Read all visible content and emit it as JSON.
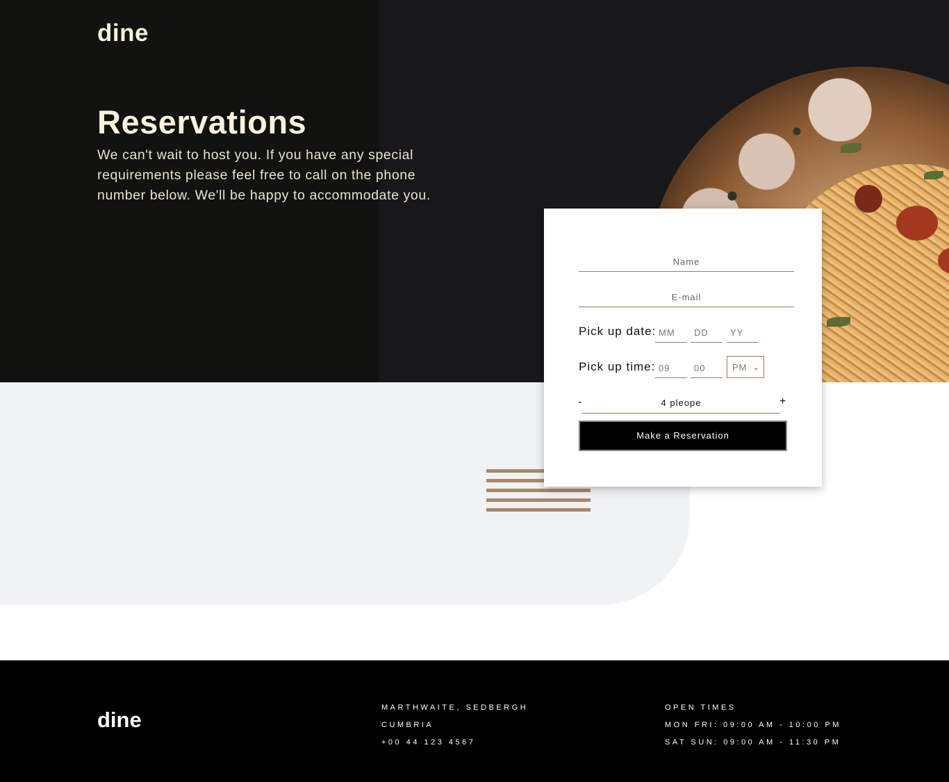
{
  "brand": {
    "logo": "dine"
  },
  "hero": {
    "title": "Reservations",
    "text": "We can't wait to host you. If you have any special requirements please feel free to call on the phone number below. We'll be happy to accommodate you."
  },
  "form": {
    "name_placeholder": "Name",
    "email_placeholder": "E-mail",
    "date_label": "Pick up date:",
    "date_mm": "MM",
    "date_dd": "DD",
    "date_yy": "YY",
    "time_label": "Pick up time:",
    "time_hh": "09",
    "time_mm": "00",
    "ampm": "PM",
    "minus": "-",
    "people": "4 pleope",
    "plus": "+",
    "submit": "Make a Reservation"
  },
  "footer": {
    "logo": "dine",
    "address": [
      "MARTHWAITE, SEDBERGH",
      "CUMBRIA",
      "+00 44 123 4567"
    ],
    "hours": [
      "OPEN TIMES",
      "MON FRI: 09:00 AM - 10:00 PM",
      "SAT SUN: 09:00 AM - 11:30 PM"
    ]
  },
  "colors": {
    "accent": "#9c7a5f",
    "cream": "#f6f2dc",
    "dark": "#121210"
  },
  "icons": {
    "select_caret": "chevron-down-icon"
  }
}
